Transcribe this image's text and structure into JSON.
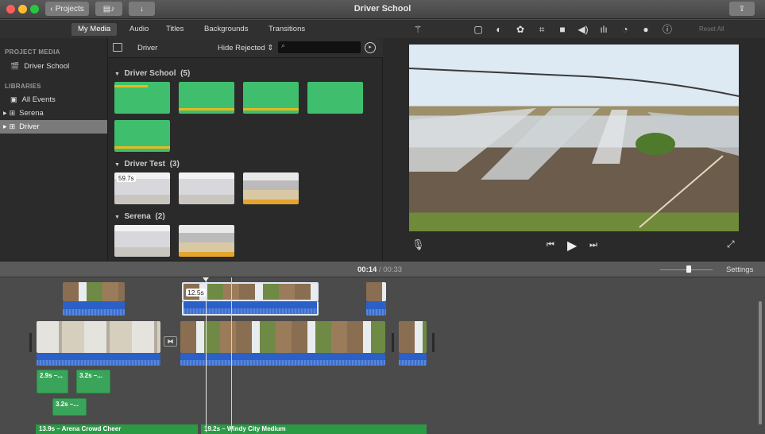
{
  "window": {
    "title": "Driver School"
  },
  "toolbar": {
    "projects_label": "Projects",
    "share_icon": "share-icon"
  },
  "browser_tabs": [
    {
      "label": "My Media",
      "active": true
    },
    {
      "label": "Audio",
      "active": false
    },
    {
      "label": "Titles",
      "active": false
    },
    {
      "label": "Backgrounds",
      "active": false
    },
    {
      "label": "Transitions",
      "active": false
    }
  ],
  "sidebar": {
    "project_media_header": "PROJECT MEDIA",
    "project_item": "Driver School",
    "libraries_header": "LIBRARIES",
    "items": [
      {
        "label": "All Events",
        "selected": false
      },
      {
        "label": "Serena",
        "selected": false
      },
      {
        "label": "Driver",
        "selected": true
      }
    ]
  },
  "browser": {
    "library_name": "Driver",
    "filter": "Hide Rejected",
    "search_placeholder": "",
    "events": [
      {
        "name": "Driver School",
        "count": "(5)"
      },
      {
        "name": "Driver Test",
        "count": "(3)",
        "first_duration": "59.7s"
      },
      {
        "name": "Serena",
        "count": "(2)"
      }
    ]
  },
  "inspector": {
    "reset_all": "Reset All"
  },
  "playback": {
    "current_time": "00:14",
    "separator": "/",
    "total_time": "00:33",
    "settings_label": "Settings",
    "zoom_level": 0.55
  },
  "timeline": {
    "selected_clip_duration": "12.5s",
    "audio_clips": [
      "2.9s –...",
      "3.2s –...",
      "3.2s –..."
    ],
    "music_tracks": [
      "13.9s – Arena Crowd Cheer",
      "19.2s – Windy City Medium"
    ]
  }
}
